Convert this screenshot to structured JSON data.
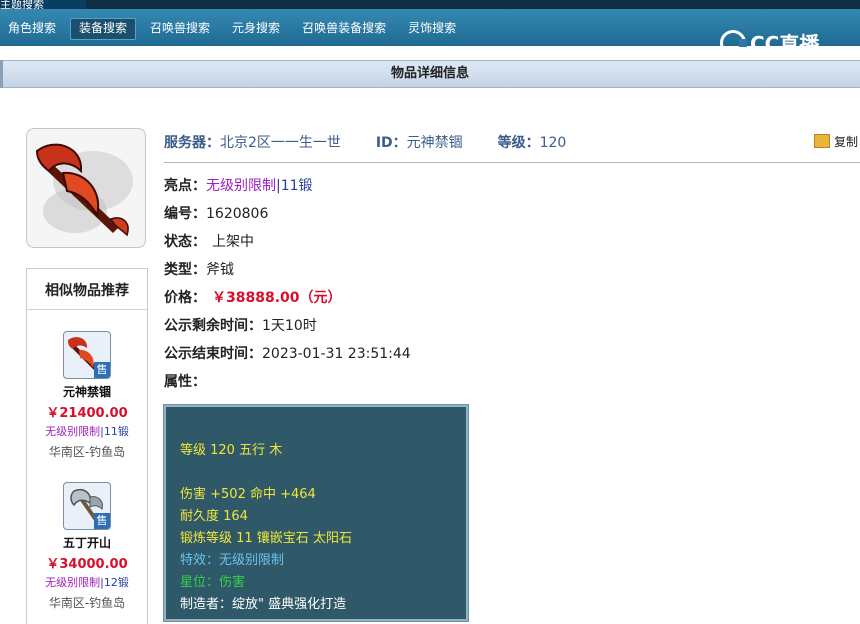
{
  "topbar": {
    "tab_label": "主题搜索"
  },
  "nav": [
    "角色搜索",
    "装备搜索",
    "召唤兽搜索",
    "元身搜索",
    "召唤兽装备搜索",
    "灵饰搜索"
  ],
  "brand": {
    "text": "CC直播"
  },
  "detail_title": "物品详细信息",
  "sidebar": {
    "title": "相似物品推荐",
    "items": [
      {
        "name": "元神禁锢",
        "price": "￥21400.00",
        "tag1": "无级别限制",
        "tag2": "11锻",
        "server": "华南区-钓鱼岛",
        "badge": "售"
      },
      {
        "name": "五丁开山",
        "price": "￥34000.00",
        "tag1": "无级别限制",
        "tag2": "12锻",
        "server": "华南区-钓鱼岛",
        "badge": "售"
      }
    ]
  },
  "info": {
    "server_label": "服务器：",
    "server_value": "北京2区一一生一世",
    "id_label": "ID：",
    "id_value": "元神禁锢",
    "level_label": "等级：",
    "level_value": "120",
    "copy_label": "复制"
  },
  "details": {
    "highlight_label": "亮点：",
    "highlight_value1": "无级别限制",
    "highlight_sep": "|",
    "highlight_value2": "11锻",
    "code_label": "编号：",
    "code_value": "1620806",
    "status_label": "状态：",
    "status_value": "上架中",
    "type_label": "类型：",
    "type_value": "斧钺",
    "price_label": "价格：",
    "price_value": "￥38888.00（元）",
    "remain_label": "公示剩余时间：",
    "remain_value": "1天10时",
    "end_label": "公示结束时间：",
    "end_value": "2023-01-31 23:51:44",
    "attr_label": "属性："
  },
  "attributes": {
    "line1": "等级 120  五行 木",
    "line2": "伤害 +502 命中 +464",
    "line3": "耐久度 164",
    "line4": "锻炼等级 11  镶嵌宝石 太阳石",
    "line5": "特效：无级别限制",
    "line6": "星位：伤害",
    "line7": "制造者：绽放\" 盛典强化打造"
  },
  "colors": {
    "attr_yellow": "#f0e63a",
    "attr_blue": "#6cc0f0",
    "attr_green": "#33d24a",
    "price_red": "#d8102c",
    "tag_purple": "#a020c0"
  }
}
